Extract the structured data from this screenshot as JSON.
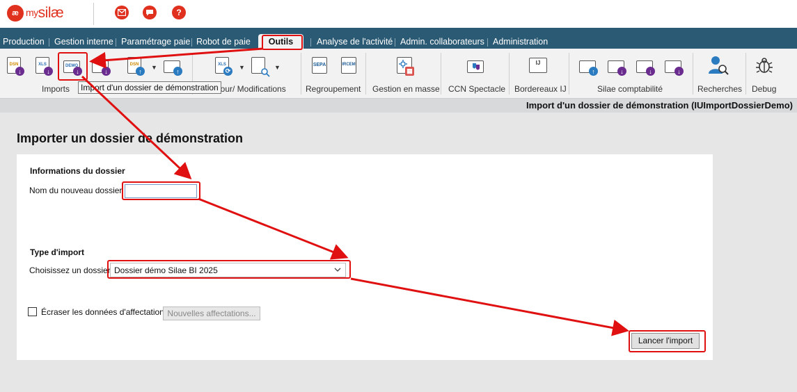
{
  "app": {
    "logo_mark": "æ",
    "logo_my": "my",
    "logo_name": "silæ",
    "brand_color": "#e0301e",
    "header_icons": [
      "mail-icon",
      "chat-icon",
      "help-icon"
    ],
    "help_glyph": "?"
  },
  "menu": {
    "items": [
      "Production",
      "Gestion interne",
      "Paramétrage paie",
      "Robot de paie",
      "Outils",
      "Analyse de l'activité",
      "Admin. collaborateurs",
      "Administration"
    ],
    "active": "Outils"
  },
  "ribbon": {
    "groups": [
      "Imports",
      "jour/ Modifications",
      "Regroupement",
      "Gestion en masse",
      "CCN Spectacle",
      "Bordereaux IJ",
      "Silae comptabilité",
      "Recherches",
      "Debug"
    ],
    "icon_labels": {
      "dsn": "DSN",
      "xls": "XLS",
      "demo": "DEMO",
      "sepa": "SEPA",
      "ircem": "IRCEM",
      "ij": "IJ"
    },
    "tooltip": "Import d'un dossier de démonstration"
  },
  "title_bar": "Import d'un dossier de démonstration (IUImportDossierDemo)",
  "page": {
    "title": "Importer un dossier de démonstration",
    "section_info": "Informations du dossier",
    "folder_name_label": "Nom du nouveau dossier :",
    "folder_name_value": "",
    "section_type": "Type d'import",
    "choose_label": "Choisissez un dossier :",
    "choose_value": "Dossier démo Silae BI 2025",
    "overwrite_label": "Écraser les données d'affectation",
    "overwrite_checked": false,
    "new_assignments_button": "Nouvelles affectations...",
    "launch_button": "Lancer l'import"
  },
  "annotation_color": "#e01010"
}
